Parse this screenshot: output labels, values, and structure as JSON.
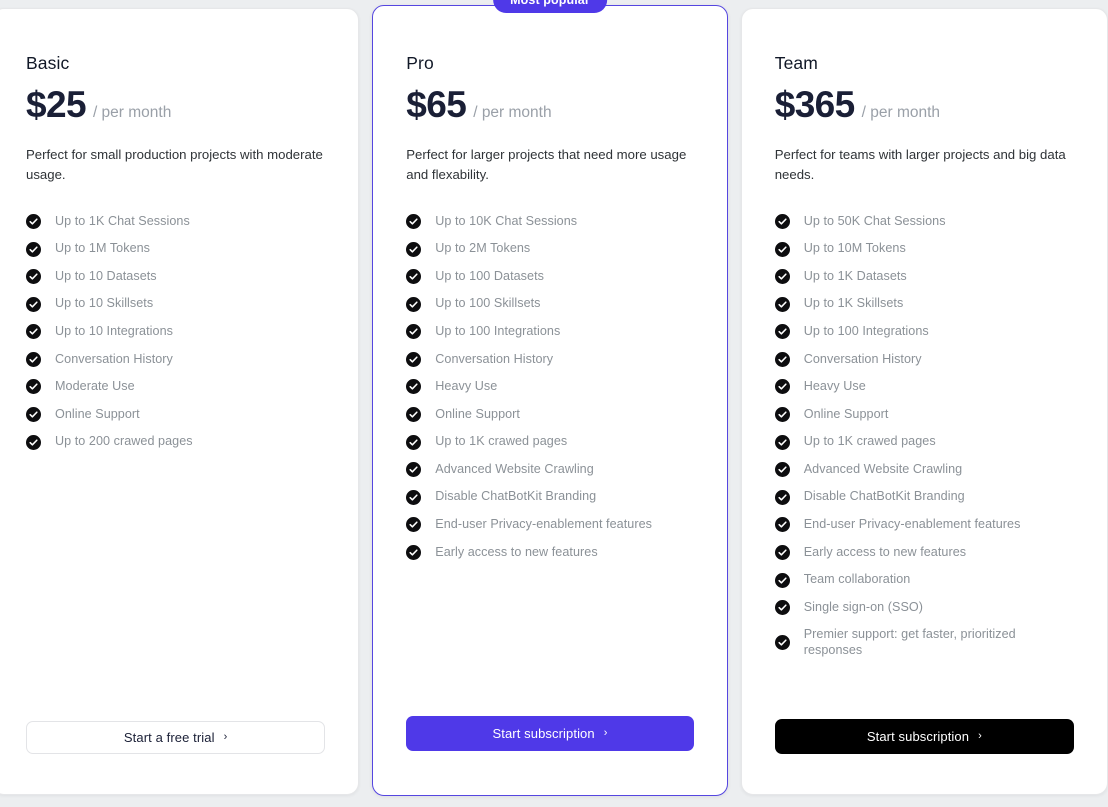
{
  "plans": [
    {
      "name": "Basic",
      "price": "$25",
      "period": "/ per month",
      "description": "Perfect for small production projects with moderate usage.",
      "badge": null,
      "features": [
        "Up to 1K Chat Sessions",
        "Up to 1M Tokens",
        "Up to 10 Datasets",
        "Up to 10 Skillsets",
        "Up to 10 Integrations",
        "Conversation History",
        "Moderate Use",
        "Online Support",
        "Up to 200 crawed pages"
      ],
      "cta_label": "Start a free trial",
      "cta_arrow": "›",
      "cta_style": "outline"
    },
    {
      "name": "Pro",
      "price": "$65",
      "period": "/ per month",
      "description": "Perfect for larger projects that need more usage and flexability.",
      "badge": "Most popular",
      "features": [
        "Up to 10K Chat Sessions",
        "Up to 2M Tokens",
        "Up to 100 Datasets",
        "Up to 100 Skillsets",
        "Up to 100 Integrations",
        "Conversation History",
        "Heavy Use",
        "Online Support",
        "Up to 1K crawed pages",
        "Advanced Website Crawling",
        "Disable ChatBotKit Branding",
        "End-user Privacy-enablement features",
        "Early access to new features"
      ],
      "cta_label": "Start subscription",
      "cta_arrow": "›",
      "cta_style": "purple"
    },
    {
      "name": "Team",
      "price": "$365",
      "period": "/ per month",
      "description": "Perfect for teams with larger projects and big data needs.",
      "badge": null,
      "features": [
        "Up to 50K Chat Sessions",
        "Up to 10M Tokens",
        "Up to 1K Datasets",
        "Up to 1K Skillsets",
        "Up to 100 Integrations",
        "Conversation History",
        "Heavy Use",
        "Online Support",
        "Up to 1K crawed pages",
        "Advanced Website Crawling",
        "Disable ChatBotKit Branding",
        "End-user Privacy-enablement features",
        "Early access to new features",
        "Team collaboration",
        "Single sign-on (SSO)",
        "Premier support: get faster, prioritized responses"
      ],
      "cta_label": "Start subscription",
      "cta_arrow": "›",
      "cta_style": "dark"
    }
  ],
  "colors": {
    "accent": "#4f39e8",
    "page_background": "#eceef0",
    "card_background": "#ffffff",
    "check_icon": "#0d0d0f",
    "price_text": "#1a1f36",
    "feature_text": "#8b9197",
    "dark_button": "#000000"
  },
  "icons": {
    "check": "check-circle-icon",
    "arrow": "chevron-right-icon"
  }
}
